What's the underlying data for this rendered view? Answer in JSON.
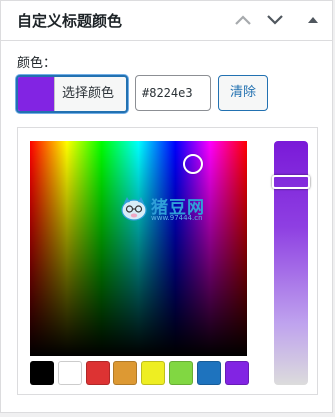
{
  "panel": {
    "title": "自定义标题颜色"
  },
  "header_controls": [
    {
      "icon": "chevron-up-icon"
    },
    {
      "icon": "chevron-down-icon"
    },
    {
      "icon": "triangle-up-icon"
    }
  ],
  "field": {
    "label": "颜色：",
    "current_color": "#8224e3",
    "select_button_label": "选择颜色",
    "hex_value": "#8224e3",
    "clear_label": "清除"
  },
  "picker": {
    "palette": [
      "#000000",
      "#ffffff",
      "#dd3333",
      "#dd9933",
      "#eeee22",
      "#81d742",
      "#1e73be",
      "#8224e3"
    ]
  },
  "watermark": {
    "main": "猪豆网",
    "sub": "www.97444.cn"
  }
}
